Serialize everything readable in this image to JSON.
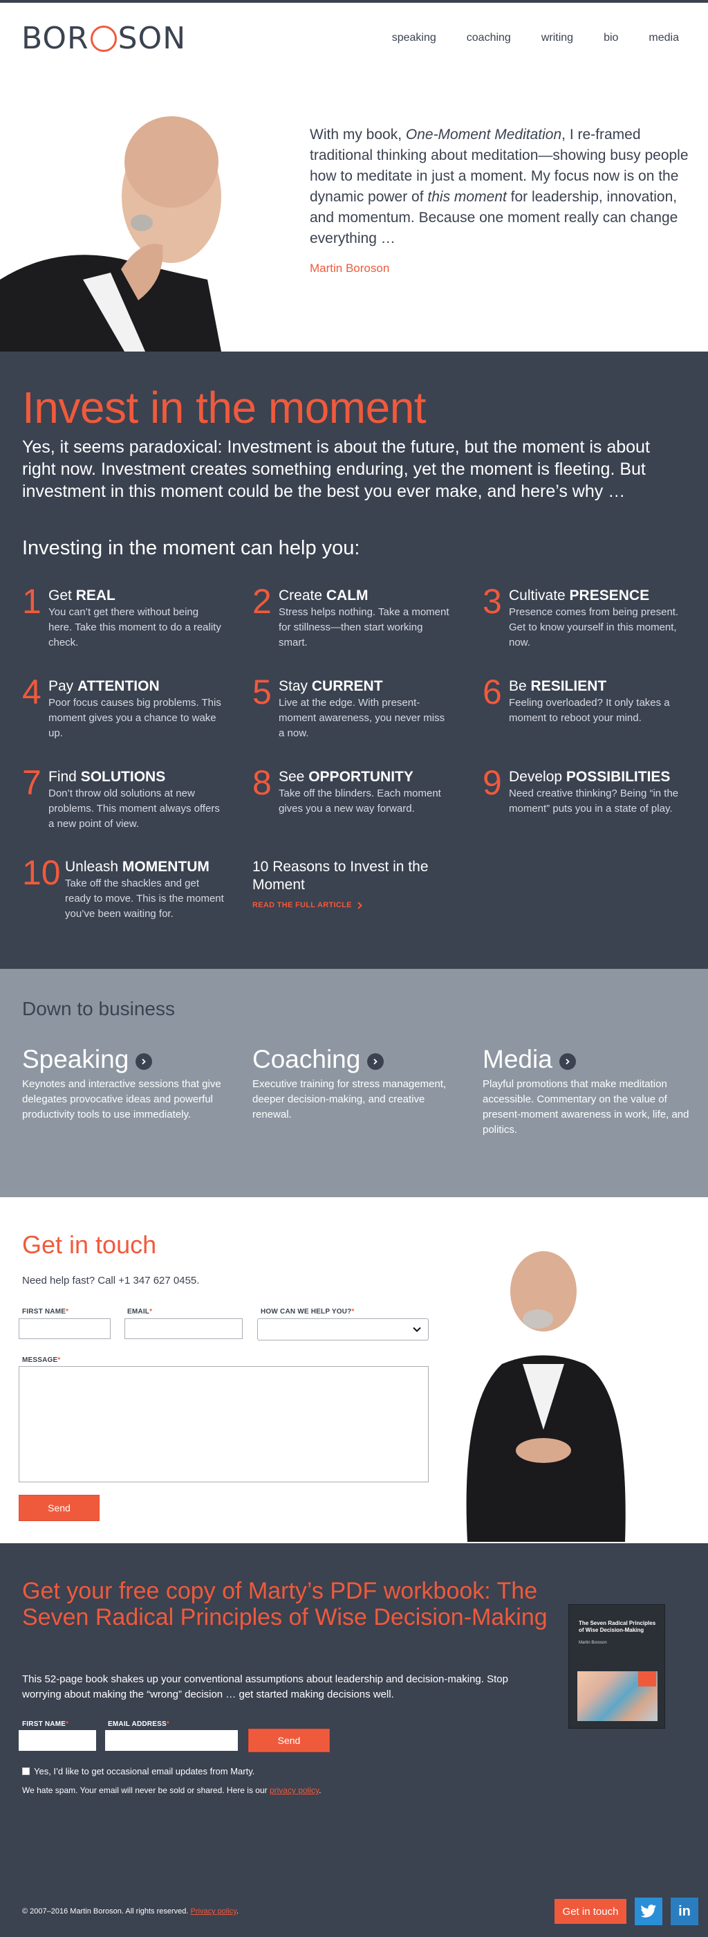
{
  "header": {
    "logo": "BOROSON",
    "logo_left": "BOR",
    "logo_right": "SON",
    "nav": [
      "speaking",
      "coaching",
      "writing",
      "bio",
      "media"
    ]
  },
  "hero": {
    "quote_a": "With my book, ",
    "quote_book": "One-Moment Meditation",
    "quote_b": ", I re-framed traditional thinking about meditation—showing busy people how to meditate in just a moment. My focus now is on the dynamic power of ",
    "quote_em": "this moment",
    "quote_c": " for leadership, innovation, and momentum. Because one moment really can change everything …",
    "signature": "Martin Boroson"
  },
  "invest": {
    "title": "Invest in the moment",
    "intro": "Yes, it seems paradoxical: Investment is about the future, but the moment is about right now. Investment creates something enduring, yet the moment is fleeting. But investment in this moment could be the best you ever make, and here’s why …",
    "subtitle": "Investing in the moment can help you:",
    "reasons": [
      {
        "num": "1",
        "verb": "Get",
        "key": "REAL",
        "desc": "You can’t get there without being here. Take this moment to do a reality check."
      },
      {
        "num": "2",
        "verb": "Create",
        "key": "CALM",
        "desc": "Stress helps nothing. Take a moment for stillness—then start working smart."
      },
      {
        "num": "3",
        "verb": "Cultivate",
        "key": "PRESENCE",
        "desc": "Presence comes from being present. Get to know yourself in this moment, now."
      },
      {
        "num": "4",
        "verb": "Pay",
        "key": "ATTENTION",
        "desc": "Poor focus causes big problems. This moment gives you a chance to wake up."
      },
      {
        "num": "5",
        "verb": "Stay",
        "key": "CURRENT",
        "desc": "Live at the edge. With present-moment awareness, you never miss a now."
      },
      {
        "num": "6",
        "verb": "Be",
        "key": "RESILIENT",
        "desc": "Feeling overloaded? It only takes a moment to reboot your mind."
      },
      {
        "num": "7",
        "verb": "Find",
        "key": "SOLUTIONS",
        "desc": "Don’t throw old solutions at new problems. This moment always offers a new point of view."
      },
      {
        "num": "8",
        "verb": "See",
        "key": "OPPORTUNITY",
        "desc": "Take off the blinders. Each moment gives you a new way forward."
      },
      {
        "num": "9",
        "verb": "Develop",
        "key": "POSSIBILITIES",
        "desc": "Need creative thinking? Being “in the moment” puts you in a state of play."
      },
      {
        "num": "10",
        "verb": "Unleash",
        "key": "MOMENTUM",
        "desc": "Take off the shackles and get ready to move. This is the moment you’ve been waiting for."
      }
    ],
    "link_title": "10 Reasons to Invest in the Moment",
    "link_more": "READ THE FULL ARTICLE"
  },
  "business": {
    "title": "Down to business",
    "services": [
      {
        "name": "Speaking",
        "desc": "Keynotes and interactive sessions that give delegates provocative ideas and powerful productivity tools to use immediately."
      },
      {
        "name": "Coaching",
        "desc": "Executive training for stress management, deeper decision-making, and creative renewal."
      },
      {
        "name": "Media",
        "desc": "Playful promotions that make meditation accessible. Commentary on the value of present-moment awareness in work, life, and politics."
      }
    ]
  },
  "contact": {
    "title": "Get in touch",
    "help": "Need help fast? Call +1 347 627 0455.",
    "first_name_label": "FIRST NAME",
    "email_label": "EMAIL",
    "help_label": "HOW CAN WE HELP YOU?",
    "message_label": "MESSAGE",
    "required_mark": "*",
    "send": "Send"
  },
  "workbook": {
    "title": "Get your free copy of Marty’s PDF workbook: The Seven Radical Principles of Wise Decision-Making",
    "blurb": "This 52-page book shakes up your conventional assumptions about leadership and decision-making. Stop worrying about making the “wrong” decision … get started making decisions well.",
    "first_name_label": "FIRST NAME",
    "email_label": "EMAIL ADDRESS",
    "send": "Send",
    "checkbox_label": "Yes, I’d like to get occasional email updates from Marty.",
    "spam_text": "We hate spam. Your email will never be sold or shared. Here is our ",
    "privacy": "privacy policy",
    "spam_end": ".",
    "cover_title": "The Seven Radical Principles of Wise Decision-Making",
    "cover_author": "Martin Boroson"
  },
  "footer": {
    "copyright": "© 2007–2016 Martin Boroson. All rights reserved. ",
    "privacy": "Privacy policy",
    "end": ".",
    "get_in_touch": "Get in touch",
    "twitter": "twitter-icon",
    "linkedin": "in"
  },
  "colors": {
    "accent": "#f05a3c",
    "dark": "#3b4250",
    "grey": "#8e97a1"
  }
}
